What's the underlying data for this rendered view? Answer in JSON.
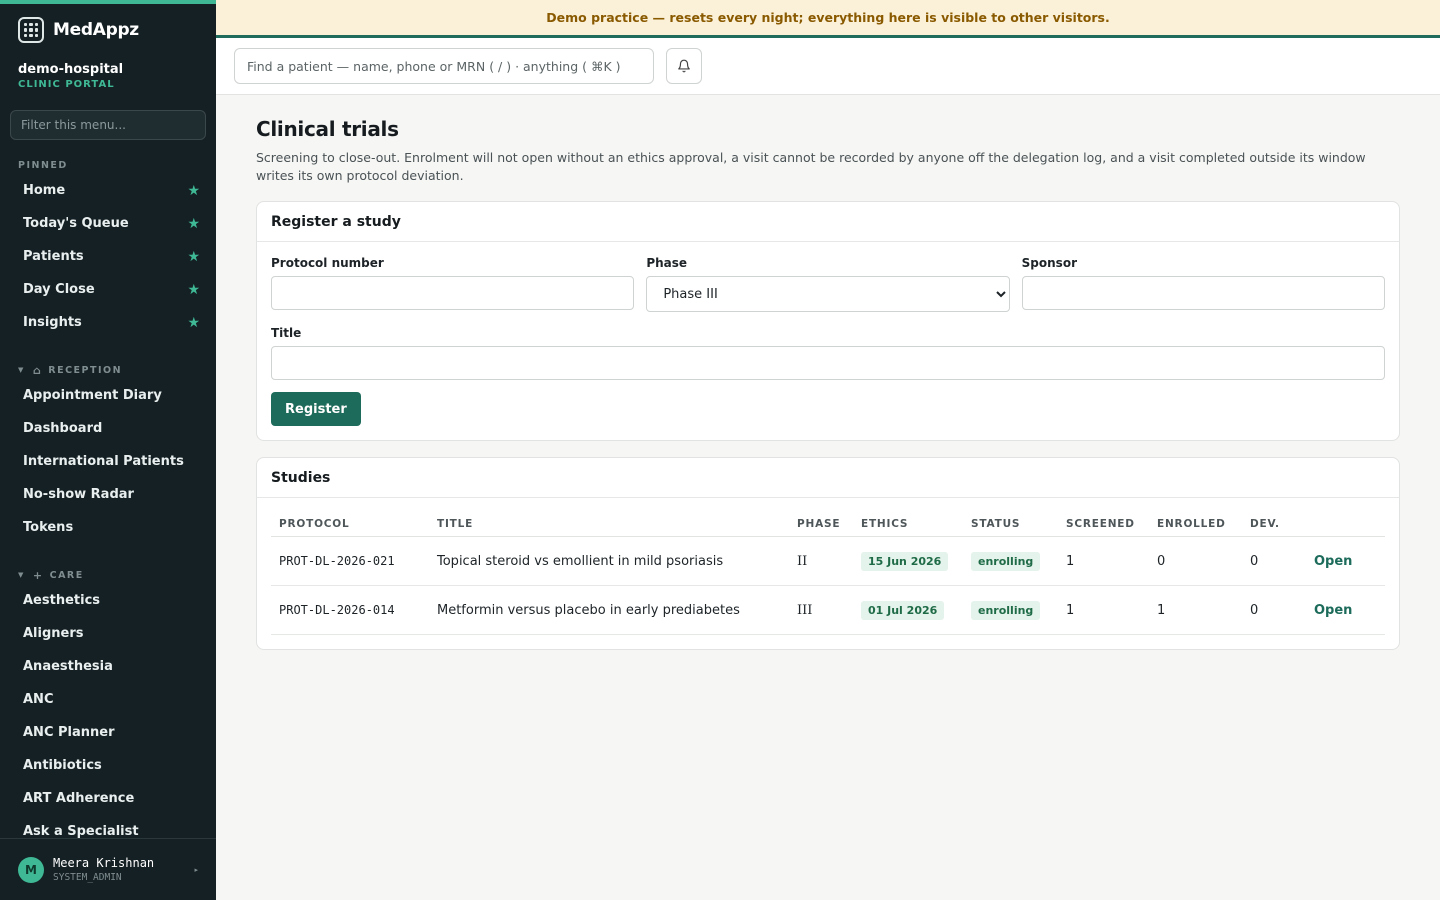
{
  "brand": {
    "name": "MedAppz"
  },
  "org": {
    "name": "demo-hospital",
    "subtitle": "CLINIC PORTAL"
  },
  "sidebar": {
    "filter_placeholder": "Filter this menu...",
    "pinned_label": "PINNED",
    "pinned": [
      {
        "label": "Home"
      },
      {
        "label": "Today's Queue"
      },
      {
        "label": "Patients"
      },
      {
        "label": "Day Close"
      },
      {
        "label": "Insights"
      }
    ],
    "reception_label": "RECEPTION",
    "reception": [
      {
        "label": "Appointment Diary"
      },
      {
        "label": "Dashboard"
      },
      {
        "label": "International Patients"
      },
      {
        "label": "No-show Radar"
      },
      {
        "label": "Tokens"
      }
    ],
    "care_label": "CARE",
    "care": [
      {
        "label": "Aesthetics"
      },
      {
        "label": "Aligners"
      },
      {
        "label": "Anaesthesia"
      },
      {
        "label": "ANC"
      },
      {
        "label": "ANC Planner"
      },
      {
        "label": "Antibiotics"
      },
      {
        "label": "ART Adherence"
      },
      {
        "label": "Ask a Specialist"
      }
    ]
  },
  "user": {
    "initial": "M",
    "name": "Meera Krishnan",
    "role": "SYSTEM_ADMIN"
  },
  "banner": {
    "text": "Demo practice — resets every night; everything here is visible to other visitors."
  },
  "topbar": {
    "search_placeholder": "Find a patient — name, phone or MRN ( / ) · anything ( ⌘K )"
  },
  "page": {
    "title": "Clinical trials",
    "description": "Screening to close-out. Enrolment will not open without an ethics approval, a visit cannot be recorded by anyone off the delegation log, and a visit completed outside its window writes its own protocol deviation."
  },
  "register": {
    "heading": "Register a study",
    "protocol_label": "Protocol number",
    "protocol_value": "",
    "phase_label": "Phase",
    "phase_value": "Phase III",
    "sponsor_label": "Sponsor",
    "sponsor_value": "",
    "title_label": "Title",
    "title_value": "",
    "button": "Register"
  },
  "studies": {
    "heading": "Studies",
    "columns": {
      "protocol": "PROTOCOL",
      "title": "TITLE",
      "phase": "PHASE",
      "ethics": "ETHICS",
      "status": "STATUS",
      "screened": "SCREENED",
      "enrolled": "ENROLLED",
      "dev": "DEV."
    },
    "rows": [
      {
        "protocol": "PROT-DL-2026-021",
        "title": "Topical steroid vs emollient in mild psoriasis",
        "phase": "II",
        "ethics": "15 Jun 2026",
        "status": "enrolling",
        "screened": "1",
        "enrolled": "0",
        "dev": "0",
        "action": "Open"
      },
      {
        "protocol": "PROT-DL-2026-014",
        "title": "Metformin versus placebo in early prediabetes",
        "phase": "III",
        "ethics": "01 Jul 2026",
        "status": "enrolling",
        "screened": "1",
        "enrolled": "1",
        "dev": "0",
        "action": "Open"
      }
    ]
  },
  "colors": {
    "accent": "#3fb995",
    "primary": "#1d6b5a",
    "sidebar_bg": "#152024",
    "banner_bg": "#fbf1d9",
    "banner_text": "#8a5a00"
  }
}
